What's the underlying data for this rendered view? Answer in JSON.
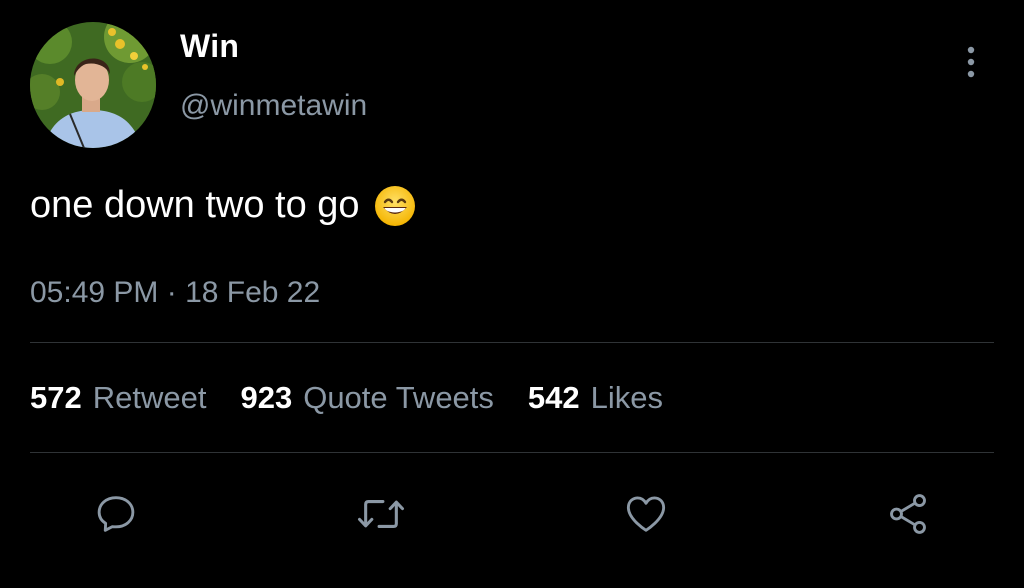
{
  "user": {
    "display_name": "Win",
    "handle": "@winmetawin",
    "avatar_icon": "profile-photo"
  },
  "tweet": {
    "text": "one down two to go",
    "emoji": "grinning-face-with-smiling-eyes",
    "timestamp": "05:49 PM · 18 Feb 22"
  },
  "stats": [
    {
      "count": "572",
      "label": "Retweet"
    },
    {
      "count": "923",
      "label": "Quote Tweets"
    },
    {
      "count": "542",
      "label": "Likes"
    }
  ],
  "actions": [
    {
      "name": "reply",
      "icon": "speech-bubble-icon"
    },
    {
      "name": "retweet",
      "icon": "retweet-icon"
    },
    {
      "name": "like",
      "icon": "heart-icon"
    },
    {
      "name": "share",
      "icon": "share-icon"
    }
  ],
  "colors": {
    "background": "#000000",
    "primary_text": "#ffffff",
    "secondary_text": "#8b98a5",
    "divider": "#2f3336",
    "icon": "#8b98a5"
  }
}
